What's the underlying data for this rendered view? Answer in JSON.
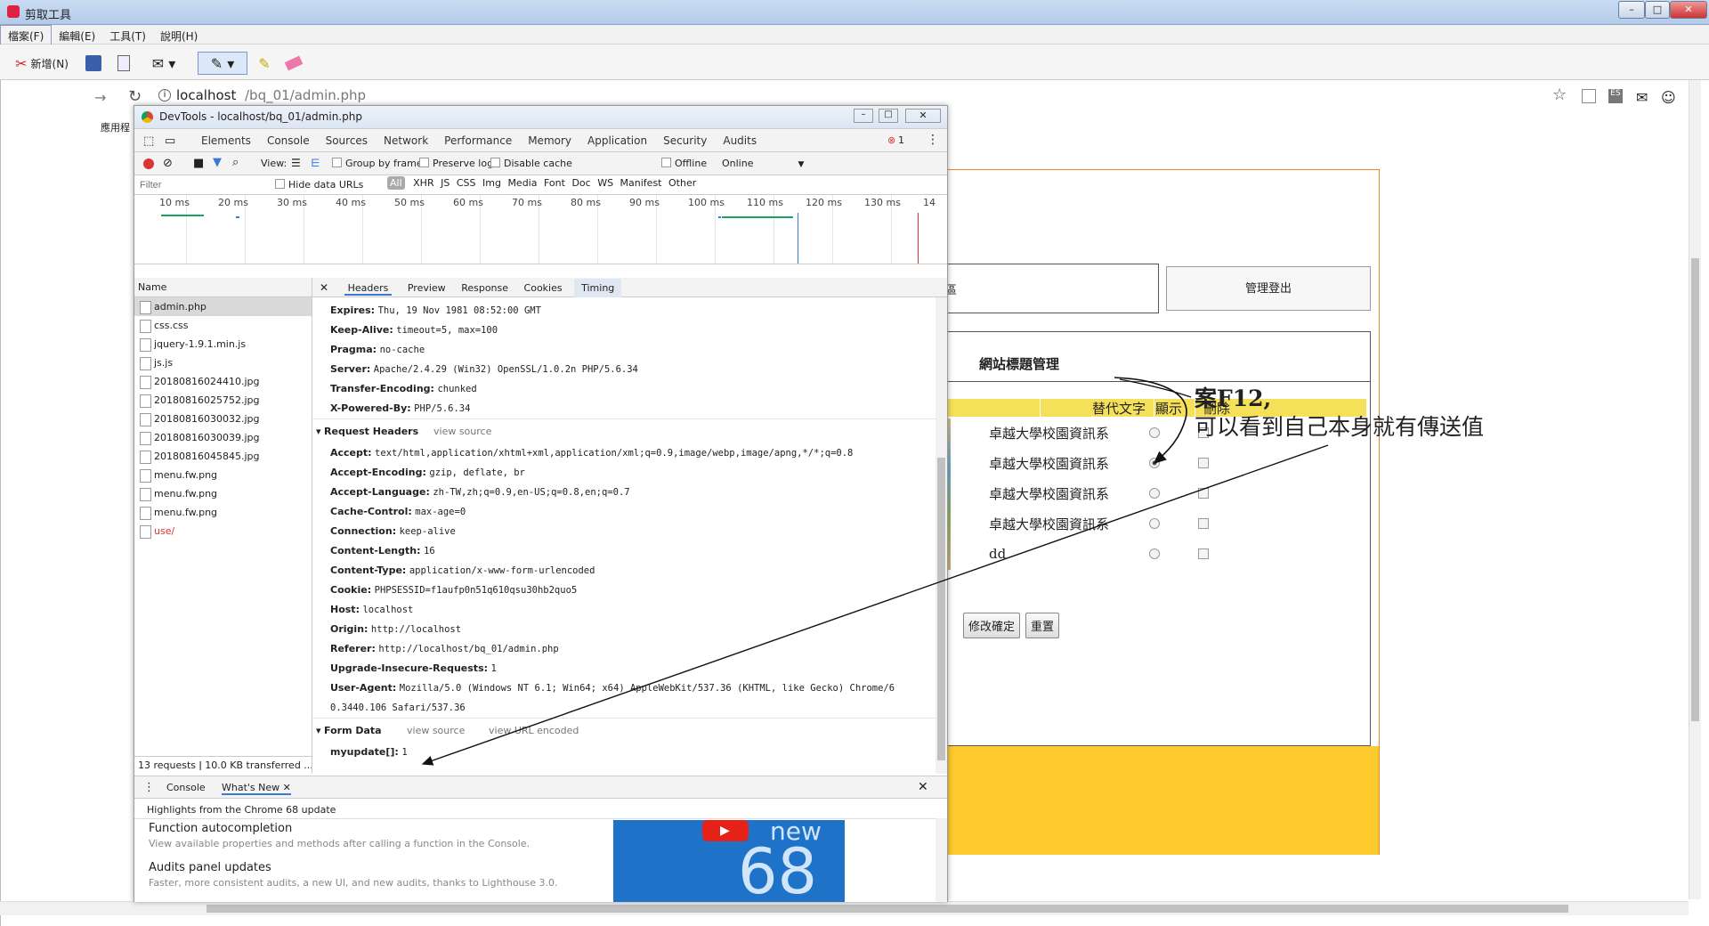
{
  "snip": {
    "title": "剪取工具",
    "menu": [
      "檔案(F)",
      "編輯(E)",
      "工具(T)",
      "說明(H)"
    ],
    "new_label": "新增(N)"
  },
  "browser": {
    "url_host": "localhost",
    "url_path": "/bq_01/admin.php",
    "bookmarks_label": "應用程"
  },
  "page": {
    "logout_label": "管理登出",
    "section_left_partial": "區",
    "heading": "網站標題管理",
    "columns": [
      "替代文字",
      "顯示",
      "刪除"
    ],
    "rows": [
      "卓越大學校園資訊系",
      "卓越大學校園資訊系",
      "卓越大學校園資訊系",
      "卓越大學校園資訊系",
      "dd"
    ],
    "submit_label": "修改確定",
    "reset_label": "重置"
  },
  "annotation": {
    "line1": "案F12,",
    "line2": "可以看到自己本身就有傳送值"
  },
  "devtools": {
    "title": "DevTools - localhost/bq_01/admin.php",
    "tabs": [
      "Elements",
      "Console",
      "Sources",
      "Network",
      "Performance",
      "Memory",
      "Application",
      "Security",
      "Audits"
    ],
    "active_tab": "Network",
    "error_count": "1",
    "toolbar": {
      "view_label": "View:",
      "group_by_frame": "Group by frame",
      "preserve_log": "Preserve log",
      "disable_cache": "Disable cache",
      "offline": "Offline",
      "online": "Online"
    },
    "filter": {
      "placeholder": "Filter",
      "hide_data_urls": "Hide data URLs",
      "types": [
        "All",
        "XHR",
        "JS",
        "CSS",
        "Img",
        "Media",
        "Font",
        "Doc",
        "WS",
        "Manifest",
        "Other"
      ]
    },
    "timeline_ticks": [
      "10 ms",
      "20 ms",
      "30 ms",
      "40 ms",
      "50 ms",
      "60 ms",
      "70 ms",
      "80 ms",
      "90 ms",
      "100 ms",
      "110 ms",
      "120 ms",
      "130 ms",
      "14"
    ],
    "name_header": "Name",
    "files": [
      "admin.php",
      "css.css",
      "jquery-1.9.1.min.js",
      "js.js",
      "20180816024410.jpg",
      "20180816025752.jpg",
      "20180816030032.jpg",
      "20180816030039.jpg",
      "20180816045845.jpg",
      "menu.fw.png",
      "menu.fw.png",
      "menu.fw.png",
      "use/"
    ],
    "status": "13 requests ǀ 10.0 KB transferred ...",
    "detail_tabs": [
      "Headers",
      "Preview",
      "Response",
      "Cookies",
      "Timing"
    ],
    "response_headers": [
      {
        "k": "Expires:",
        "v": "Thu, 19 Nov 1981 08:52:00 GMT"
      },
      {
        "k": "Keep-Alive:",
        "v": "timeout=5, max=100"
      },
      {
        "k": "Pragma:",
        "v": "no-cache"
      },
      {
        "k": "Server:",
        "v": "Apache/2.4.29 (Win32) OpenSSL/1.0.2n PHP/5.6.34"
      },
      {
        "k": "Transfer-Encoding:",
        "v": "chunked"
      },
      {
        "k": "X-Powered-By:",
        "v": "PHP/5.6.34"
      }
    ],
    "request_section": "Request Headers",
    "view_source": "view source",
    "request_headers": [
      {
        "k": "Accept:",
        "v": "text/html,application/xhtml+xml,application/xml;q=0.9,image/webp,image/apng,*/*;q=0.8"
      },
      {
        "k": "Accept-Encoding:",
        "v": "gzip, deflate, br"
      },
      {
        "k": "Accept-Language:",
        "v": "zh-TW,zh;q=0.9,en-US;q=0.8,en;q=0.7"
      },
      {
        "k": "Cache-Control:",
        "v": "max-age=0"
      },
      {
        "k": "Connection:",
        "v": "keep-alive"
      },
      {
        "k": "Content-Length:",
        "v": "16"
      },
      {
        "k": "Content-Type:",
        "v": "application/x-www-form-urlencoded"
      },
      {
        "k": "Cookie:",
        "v": "PHPSESSID=f1aufp0n51q610qsu30hb2quo5"
      },
      {
        "k": "Host:",
        "v": "localhost"
      },
      {
        "k": "Origin:",
        "v": "http://localhost"
      },
      {
        "k": "Referer:",
        "v": "http://localhost/bq_01/admin.php"
      },
      {
        "k": "Upgrade-Insecure-Requests:",
        "v": "1"
      },
      {
        "k": "User-Agent:",
        "v": "Mozilla/5.0 (Windows NT 6.1; Win64; x64) AppleWebKit/537.36 (KHTML, like Gecko) Chrome/6"
      },
      {
        "k": "",
        "v": "0.3440.106 Safari/537.36"
      }
    ],
    "form_section": "Form Data",
    "view_url_encoded": "view URL encoded",
    "form_data": {
      "k": "myupdate[]:",
      "v": "1"
    },
    "drawer": {
      "tabs": [
        "Console",
        "What's New"
      ],
      "highlight": "Highlights from the Chrome 68 update",
      "items": [
        {
          "title": "Function autocompletion",
          "desc": "View available properties and methods after calling a function in the Console."
        },
        {
          "title": "Audits panel updates",
          "desc": "Faster, more consistent audits, a new UI, and new audits, thanks to Lighthouse 3.0."
        }
      ],
      "badge_top": "new",
      "badge_num": "68"
    }
  },
  "colors": {
    "accent": "#3879d9",
    "page_border": "#e8872f",
    "yellow": "#fdcb2e",
    "header_yellow": "#f5e05a",
    "badge_blue": "#1e73c8"
  }
}
